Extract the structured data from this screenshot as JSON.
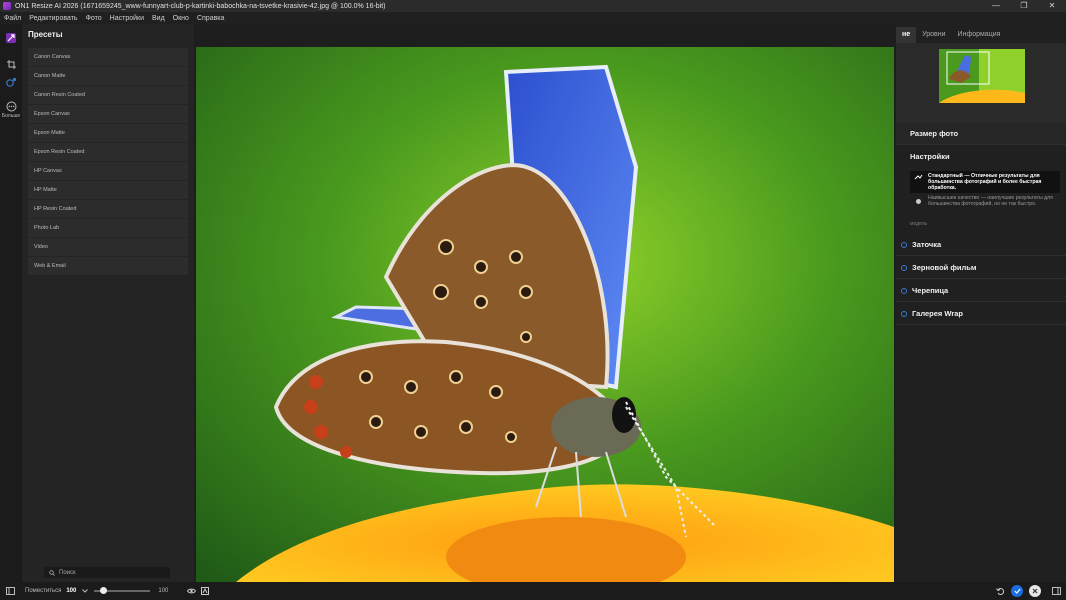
{
  "titlebar": {
    "title": "ON1 Resize AI 2026 (1671659245_www-funnyart-club-p-kartinki-babochka-na-tsvetke-krasivie-42.jpg @ 100.0% 16-bit)",
    "controls": [
      "—",
      "❐",
      "✕"
    ]
  },
  "menu": [
    "Файл",
    "Редактировать",
    "Фото",
    "Настройки",
    "Вид",
    "Окно",
    "Справка"
  ],
  "toolrail": {
    "more_label": "Больше"
  },
  "presets": {
    "title": "Пресеты",
    "items": [
      "Canon Canvas",
      "Canon Matte",
      "Canon Resin Coated",
      "Epson Canvas",
      "Epson Matte",
      "Epson Resin Coated",
      "HP Canvas",
      "HP Matte",
      "HP Resin Coated",
      "Photo Lab",
      "Video",
      "Web & Email"
    ],
    "search_placeholder": "Поиск"
  },
  "right_panel": {
    "tabs": [
      "не",
      "Уровни",
      "Информация"
    ],
    "photo_size": "Размер фото",
    "settings": "Настройки",
    "options": [
      {
        "text": "Стандартный — Отличные результаты для большинства фотографий и более быстрая обработка.",
        "selected": true
      },
      {
        "text": "Наивысшее качество — наилучшие результаты для большинства фотографий, но не так быстро.",
        "selected": false
      }
    ],
    "model_label": "модель",
    "sections": [
      "Заточка",
      "Зерновой фильм",
      "Черепица",
      "Галерея Wrap"
    ]
  },
  "statusbar": {
    "fit_label": "Поместиться",
    "zoom": "100",
    "slider_max": "100",
    "slider_value": 0.15,
    "accent": "#1a6fe0"
  }
}
